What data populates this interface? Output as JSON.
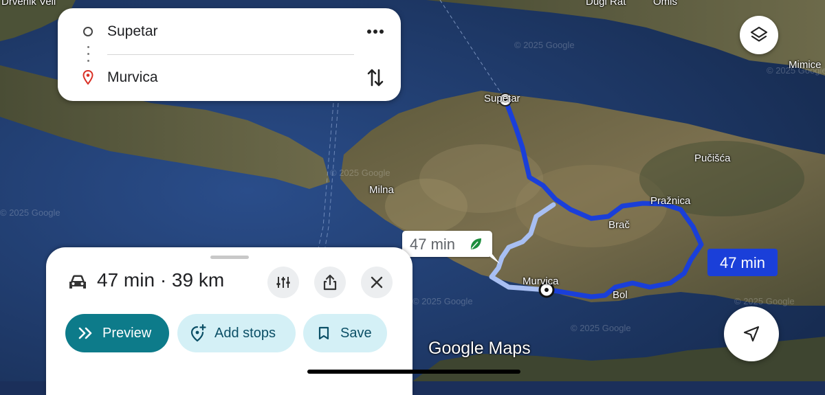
{
  "map": {
    "places": {
      "drvenik_veli": "Drvenik Veli",
      "dugi_rat": "Dugi Rat",
      "omis": "Omiš",
      "mimice": "Mimice",
      "supetar": "Supetar",
      "pucisca": "Pučišća",
      "milna": "Milna",
      "praznica": "Pražnica",
      "brac": "Brač",
      "murvica": "Murvica",
      "bol": "Bol"
    },
    "watermark": "© 2025 Google"
  },
  "route_card": {
    "origin": "Supetar",
    "destination": "Murvica",
    "origin_icon": "circle-outline-icon",
    "destination_icon": "red-pin-icon",
    "more_icon": "more-horizontal-icon",
    "swap_icon": "swap-vertical-icon"
  },
  "route_labels": {
    "alternate": "47 min",
    "alternate_icon": "eco-leaf-icon",
    "main": "47 min"
  },
  "sheet": {
    "summary": "47 min · 39 km",
    "car_icon": "car-icon",
    "options_icon": "tune-icon",
    "share_icon": "share-icon",
    "close_icon": "close-icon",
    "preview_label": "Preview",
    "add_stops_label": "Add stops",
    "save_label": "Save"
  },
  "branding": "Google Maps",
  "colors": {
    "main_route": "#1a3fd9",
    "alt_route": "#a8bff2",
    "preview_bg": "#0d7b8a",
    "secondary_bg": "#d4f0f6",
    "destination_pin": "#d93025"
  }
}
